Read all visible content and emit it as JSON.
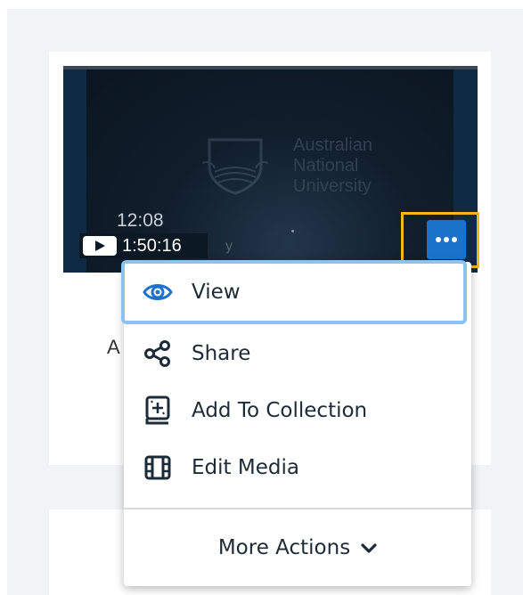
{
  "thumbnail": {
    "university_name_lines": [
      "Australian",
      "National",
      "University"
    ],
    "time_overlay": "12:08",
    "faint_letter": "y",
    "duration": "1:50:16"
  },
  "card": {
    "title_visible": "A"
  },
  "icons": {
    "play": "play-icon",
    "more": "more-dots-icon",
    "view": "eye-icon",
    "share": "share-icon",
    "add_to_collection": "collection-add-icon",
    "edit_media": "film-strip-icon",
    "more_actions": "chevron-down-icon"
  },
  "menu": {
    "items": [
      {
        "label": "View"
      },
      {
        "label": "Share"
      },
      {
        "label": "Add To Collection"
      },
      {
        "label": "Edit Media"
      }
    ],
    "more_actions_label": "More Actions"
  },
  "colors": {
    "accent": "#1a73c8",
    "highlight": "#f2b91a",
    "focus_ring": "#8cc2ee"
  }
}
